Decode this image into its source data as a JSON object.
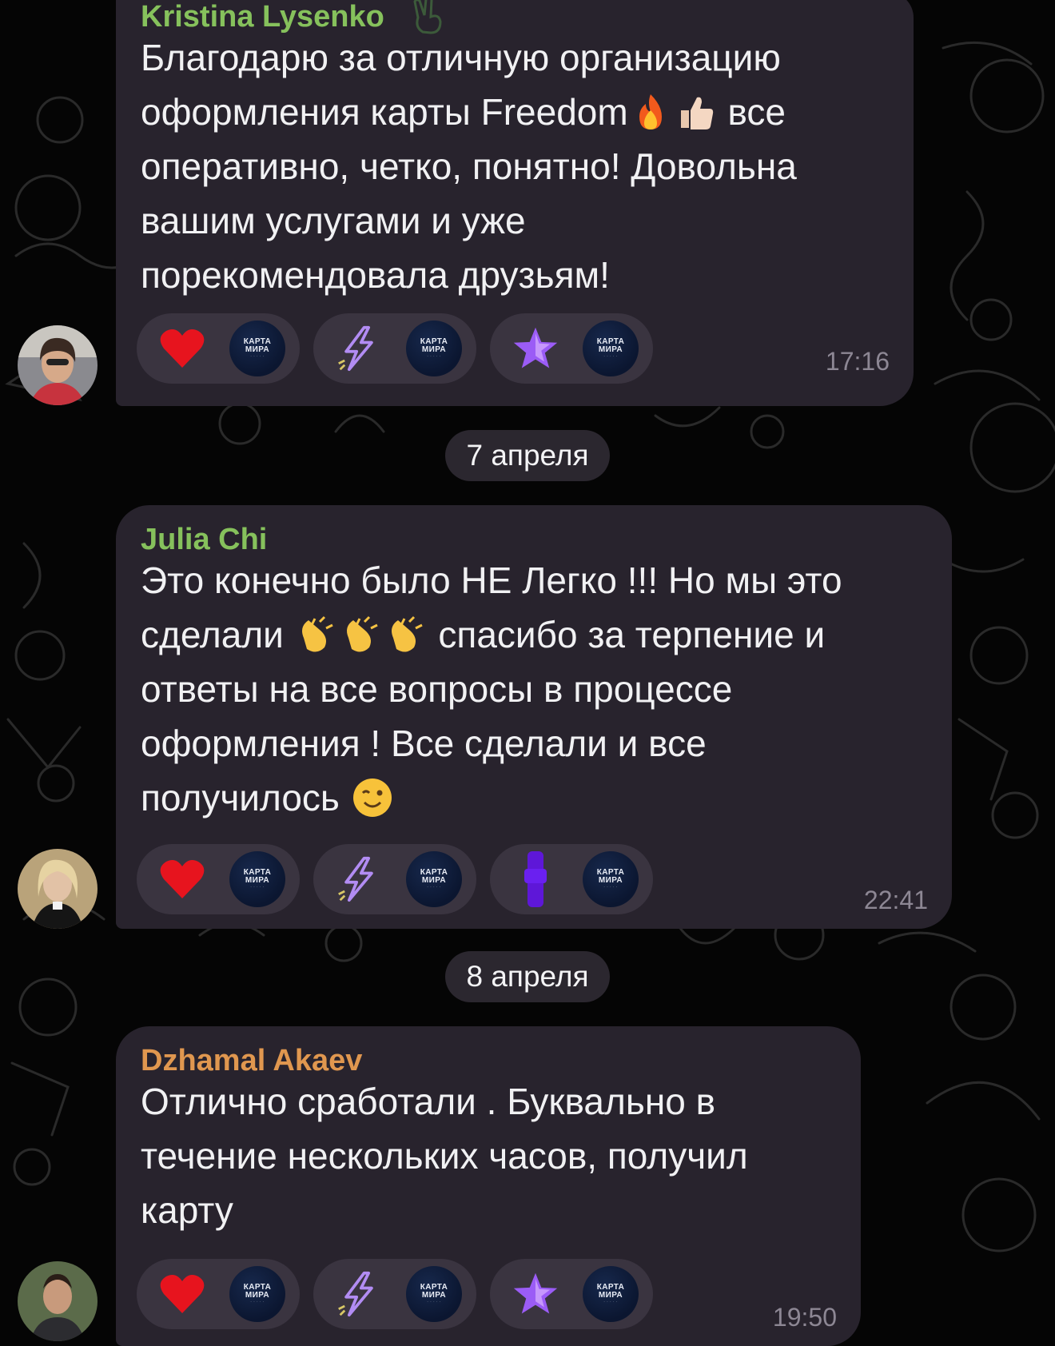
{
  "chat": {
    "messages": [
      {
        "sender": "Kristina Lysenko",
        "sender_color": "#86c15c",
        "text_lines": [
          "Благодарю за отличную организацию",
          "оформления карты Freedom",
          "оперативно, четко, понятно! Довольна",
          "вашим услугами и уже",
          "порекомендовала друзьям!"
        ],
        "line2_tail": " все",
        "time": "17:16",
        "reactions": [
          {
            "emoji": "heart-icon"
          },
          {
            "emoji": "lightning-icon"
          },
          {
            "emoji": "star-icon"
          }
        ]
      },
      {
        "sender": "Julia Chi",
        "sender_color": "#86c15c",
        "text_lines": [
          "Это конечно было НЕ Легко !!! Но мы это",
          "сделали",
          "ответы на все вопросы в процессе",
          "оформления ! Все сделали и все",
          "получилось"
        ],
        "line2_tail": "спасибо за терпение и",
        "time": "22:41",
        "reactions": [
          {
            "emoji": "heart-icon"
          },
          {
            "emoji": "lightning-icon"
          },
          {
            "emoji": "purple-figure-icon"
          }
        ]
      },
      {
        "sender": "Dzhamal Akaev",
        "sender_color": "#e0974f",
        "text_lines": [
          "Отлично сработали . Буквально в",
          "течение нескольких часов, получил",
          "карту"
        ],
        "time": "19:50",
        "reactions": [
          {
            "emoji": "heart-icon"
          },
          {
            "emoji": "lightning-icon"
          },
          {
            "emoji": "star-icon"
          }
        ]
      }
    ],
    "date_separators": [
      "7 апреля",
      "8 апреля"
    ],
    "reaction_avatar": {
      "line1": "КАРТА",
      "line2": "МИРА"
    }
  }
}
